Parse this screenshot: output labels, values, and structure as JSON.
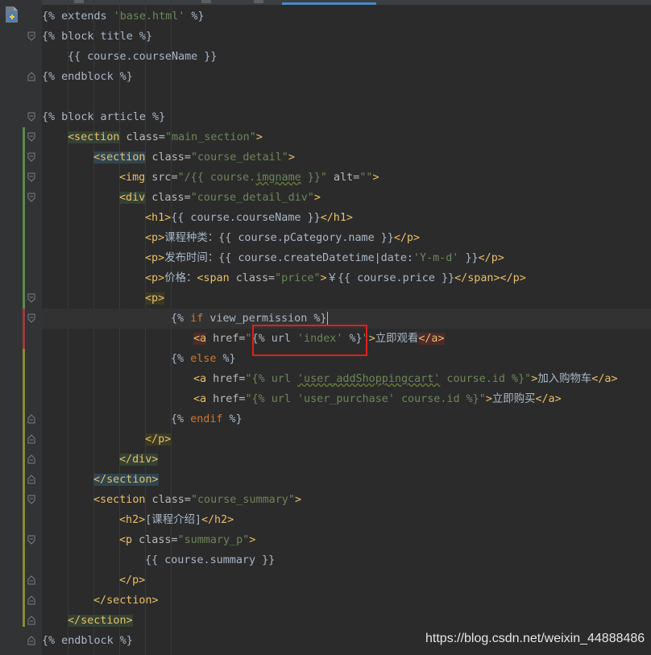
{
  "editor": {
    "file_icon": "python-file-icon",
    "colors": {
      "background": "#2b2b2b",
      "gutter": "#313335",
      "tag": "#e8bf6a",
      "string": "#6a8759",
      "keyword": "#cc7832",
      "text": "#a9b7c6",
      "highlight_box": "#e0201b"
    }
  },
  "lines": {
    "l1": {
      "a": "{% extends ",
      "b": "'base.html'",
      "c": " %}"
    },
    "l2": {
      "a": "{% block title %}"
    },
    "l3": {
      "a": "{{ course.courseName }}"
    },
    "l4": {
      "a": "{% endblock %}"
    },
    "l6": {
      "a": "{% block article %}"
    },
    "l7": {
      "a": "<section",
      "b": " class=",
      "c": "\"main_section\"",
      "d": ">"
    },
    "l8": {
      "a": "<section",
      "b": " class=",
      "c": "\"course_detail\"",
      "d": ">"
    },
    "l9": {
      "a": "<img",
      "b": " src=",
      "c": "\"/{{ course.",
      "d": "imgname",
      "e": " }}\"",
      "f": " alt=",
      "g": "\"\"",
      "h": ">"
    },
    "l10": {
      "a": "<div",
      "b": " class=",
      "c": "\"course_detail_div\"",
      "d": ">"
    },
    "l11": {
      "a": "<h1>",
      "b": "{{ course.courseName }}",
      "c": "</h1>"
    },
    "l12": {
      "a": "<p>",
      "b": "课程种类：{{ course.pCategory.name }}",
      "c": "</p>"
    },
    "l13": {
      "a": "<p>",
      "b": "发布时间：{{ course.createDatetime|date:",
      "c": "'Y-m-d'",
      "d": " }}",
      "e": "</p>"
    },
    "l14": {
      "a": "<p>",
      "b": "价格：",
      "c": "<span",
      "d": " class=",
      "e": "\"price\"",
      "f": ">",
      "g": "￥{{ course.price }}",
      "h": "</span></p>"
    },
    "l15": {
      "a": "<p>"
    },
    "l16": {
      "a": "{% ",
      "b": "if",
      "c": " view_permission %}"
    },
    "l17": {
      "a": "<a",
      "b": " href=",
      "c": "\"",
      "d": "{% url ",
      "e": "'index'",
      "f": " %}",
      "g": "\"",
      "h": ">",
      "i": "立即观看",
      "j": "</a>"
    },
    "l18": {
      "a": "{% ",
      "b": "else",
      "c": " %}"
    },
    "l19": {
      "a": "<a",
      "b": " href=",
      "c": "\"{% url ",
      "d": "'user_addShoppingcart'",
      "e": " course.id %}\"",
      "f": ">",
      "g": "加入购物车",
      "h": "</a>"
    },
    "l20": {
      "a": "<a",
      "b": " href=",
      "c": "\"{% url ",
      "d": "'user_purchase'",
      "e": " course.id %}\"",
      "f": ">",
      "g": "立即购买",
      "h": "</a>"
    },
    "l21": {
      "a": "{% ",
      "b": "endif",
      "c": " %}"
    },
    "l22": {
      "a": "</p>"
    },
    "l23": {
      "a": "</div>"
    },
    "l24": {
      "a": "</section>"
    },
    "l25": {
      "a": "<section",
      "b": " class=",
      "c": "\"course_summary\"",
      "d": ">"
    },
    "l26": {
      "a": "<h2>",
      "b": "[课程介绍]",
      "c": "</h2>"
    },
    "l27": {
      "a": "<p",
      "b": " class=",
      "c": "\"summary_p\"",
      "d": ">"
    },
    "l28": {
      "a": "{{ course.summary }}"
    },
    "l29": {
      "a": "</p>"
    },
    "l30": {
      "a": "</section>"
    },
    "l31": {
      "a": "</section>"
    },
    "l32": {
      "a": "{% endblock %}"
    }
  },
  "watermark": "https://blog.csdn.net/weixin_44888486"
}
